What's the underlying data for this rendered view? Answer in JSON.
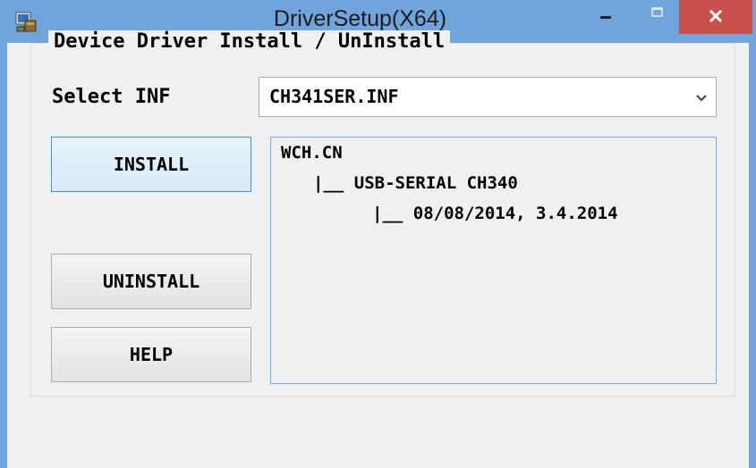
{
  "window": {
    "title": "DriverSetup(X64)",
    "accent_color": "#6fa5dc",
    "close_color": "#c7504a",
    "icons": [
      "setup-app-icon",
      "minimize-icon",
      "maximize-icon",
      "close-icon"
    ]
  },
  "group": {
    "legend": "Device Driver Install / UnInstall"
  },
  "inf": {
    "label": "Select INF",
    "selected": "CH341SER.INF"
  },
  "buttons": {
    "install": "INSTALL",
    "uninstall": "UNINSTALL",
    "help": "HELP"
  },
  "info": {
    "lines": [
      "WCH.CN",
      "|__ USB-SERIAL CH340",
      "|__ 08/08/2014, 3.4.2014"
    ]
  }
}
